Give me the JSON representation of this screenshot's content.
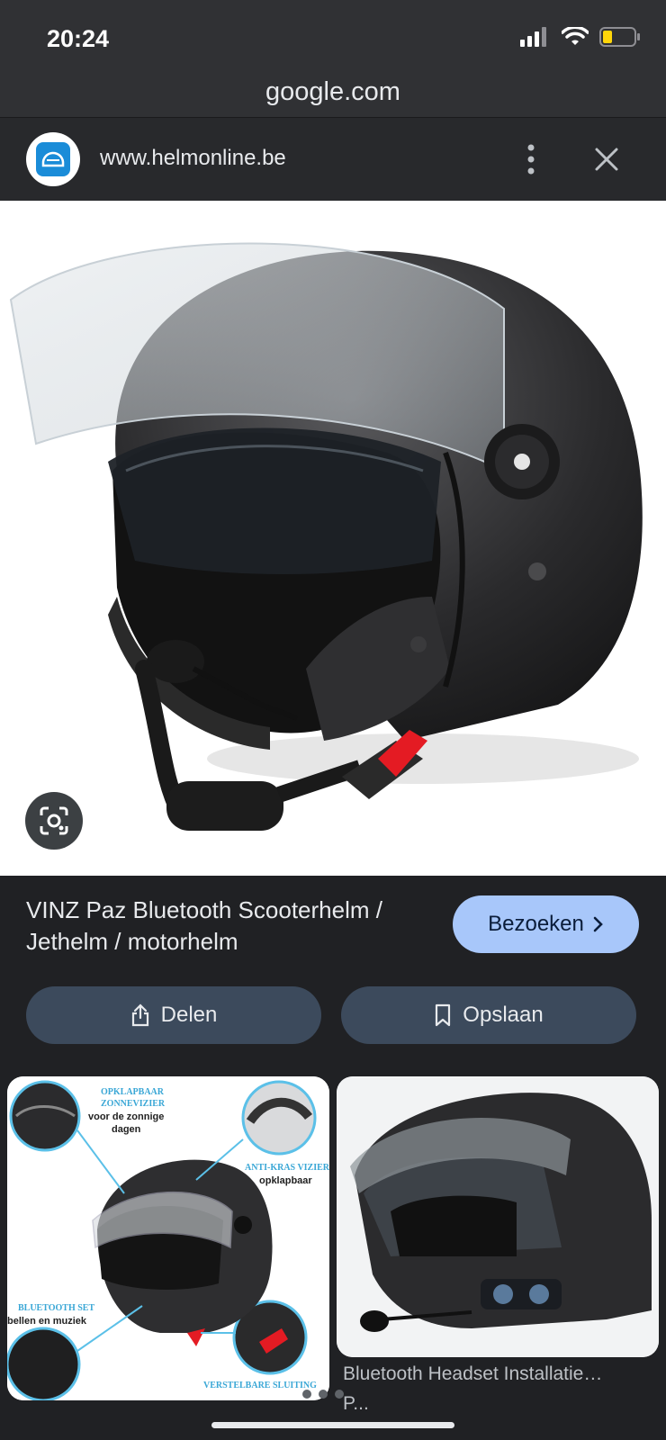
{
  "status": {
    "time": "20:24",
    "icons": [
      "signal-icon",
      "wifi-icon",
      "battery-low-icon"
    ]
  },
  "browser": {
    "url": "google.com"
  },
  "header": {
    "site": "www.helmonline.be"
  },
  "result": {
    "title": "VINZ Paz Bluetooth Scooterhelm / Jethelm / motorhelm",
    "visit_label": "Bezoeken",
    "share_label": "Delen",
    "save_label": "Opslaan"
  },
  "related": [
    {
      "callouts": [
        "OPKLAPBAAR",
        "ZONNEVIZIER",
        "voor de zonnige",
        "dagen",
        "ANTI-KRAS VIZIER",
        "opklapbaar",
        "BLUETOOTH SET",
        "bellen en muziek",
        "VERSTELBARE SLUITING"
      ]
    },
    {
      "title": "Bluetooth Headset Installatie…",
      "subtitle": "P..."
    }
  ],
  "colors": {
    "accent": "#a8c7fa",
    "action_bg": "#3c4a5c",
    "bg": "#202124"
  }
}
